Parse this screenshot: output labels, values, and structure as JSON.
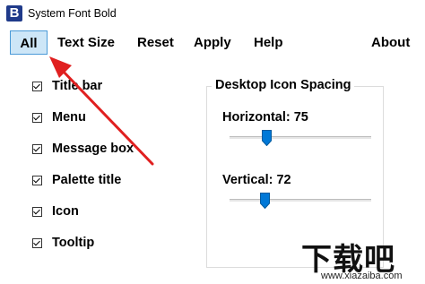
{
  "window": {
    "title": "System Font Bold",
    "icon_letter": "B"
  },
  "menu": {
    "items": [
      {
        "label": "All",
        "active": true
      },
      {
        "label": "Text Size"
      },
      {
        "label": "Reset"
      },
      {
        "label": "Apply"
      },
      {
        "label": "Help"
      },
      {
        "label": "About"
      }
    ]
  },
  "checkboxes": [
    {
      "label": "Title bar",
      "checked": true
    },
    {
      "label": "Menu",
      "checked": true
    },
    {
      "label": "Message box",
      "checked": true
    },
    {
      "label": "Palette title",
      "checked": true
    },
    {
      "label": "Icon",
      "checked": true
    },
    {
      "label": "Tooltip",
      "checked": true
    }
  ],
  "spacing": {
    "title": "Desktop Icon Spacing",
    "horizontal": {
      "label": "Horizontal: 75",
      "value": 75
    },
    "vertical": {
      "label": "Vertical: 72",
      "value": 72
    }
  },
  "watermark": {
    "text": "下载吧",
    "url": "www.xiazaiba.com"
  },
  "colors": {
    "accent": "#0078d7",
    "active_menu_bg": "#cde6f7",
    "annotation": "#e02020"
  }
}
